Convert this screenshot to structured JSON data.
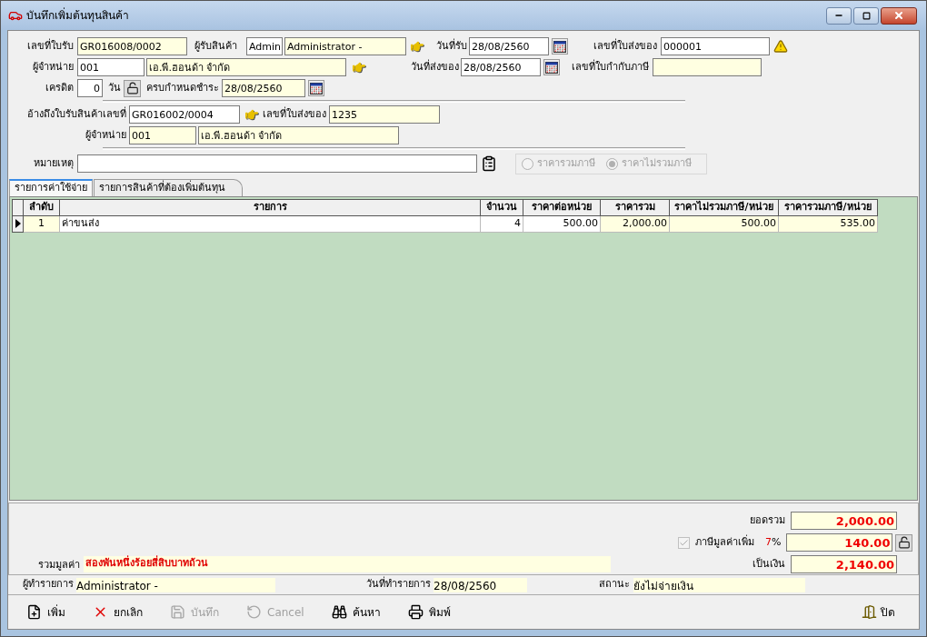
{
  "window": {
    "title": "บันทึกเพิ่มต้นทุนสินค้า"
  },
  "header": {
    "receipt_no": {
      "label": "เลขที่ใบรับ",
      "value": "GR016008/0002",
      "readonly": true
    },
    "receiver": {
      "label": "ผู้รับสินค้า",
      "code": "Admin",
      "name": "Administrator -",
      "readonly": false
    },
    "receive_date": {
      "label": "วันที่รับ",
      "value": "28/08/2560",
      "readonly": false
    },
    "delivery_no": {
      "label": "เลขที่ใบส่งของ",
      "value": "000001",
      "readonly": false,
      "warning": true
    },
    "supplier": {
      "label": "ผู้จำหน่าย",
      "code": "001",
      "name": "เอ.พี.ฮอนด้า จำกัด",
      "readonly": false
    },
    "delivery_date": {
      "label": "วันที่ส่งของ",
      "value": "28/08/2560",
      "readonly": false
    },
    "tax_invoice_no": {
      "label": "เลขที่ใบกำกับภาษี",
      "readonly": true
    },
    "credit": {
      "label": "เครดิต",
      "value": "0",
      "unit": "วัน",
      "readonly": false
    },
    "due_date": {
      "label": "ครบกำหนดชำระ",
      "value": "28/08/2560",
      "readonly": true
    },
    "reference": {
      "label": "อ้างถึงใบรับสินค้าเลขที่",
      "value": "GR016002/0004",
      "readonly": false
    },
    "ref_delivery_no": {
      "label": "เลขที่ใบส่งของ",
      "value": "1235",
      "readonly": true
    },
    "ref_supplier": {
      "label": "ผู้จำหน่าย",
      "code": "001",
      "name": "เอ.พี.ฮอนด้า จำกัด",
      "readonly": true
    },
    "note": {
      "label": "หมายเหตุ",
      "readonly": false
    },
    "price_mode": [
      {
        "label": "ราคารวมภาษี",
        "selected": false,
        "disabled": true
      },
      {
        "label": "ราคาไม่รวมภาษี",
        "selected": true,
        "disabled": true
      }
    ]
  },
  "tabs": [
    {
      "label": "รายการค่าใช้จ่าย",
      "selected": true
    },
    {
      "label": "รายการสินค้าที่ต้องเพิ่มต้นทุน",
      "selected": false
    }
  ],
  "table": {
    "columns": [
      {
        "label": "ลำดับ",
        "kind": "index",
        "readonly": true
      },
      {
        "label": "รายการ",
        "kind": "text",
        "readonly": false
      },
      {
        "label": "จำนวน",
        "kind": "number",
        "readonly": false
      },
      {
        "label": "ราคาต่อหน่วย",
        "kind": "number",
        "readonly": false
      },
      {
        "label": "ราคารวม",
        "kind": "number",
        "readonly": true
      },
      {
        "label": "ราคาไม่รวมภาษี/หน่วย",
        "kind": "number",
        "readonly": true
      },
      {
        "label": "ราคารวมภาษี/หน่วย",
        "kind": "number",
        "readonly": true
      }
    ],
    "rows": [
      {
        "selected": true,
        "cells": [
          "1",
          "ค่าขนส่ง",
          "4",
          "500.00",
          "2,000.00",
          "500.00",
          "535.00"
        ]
      }
    ]
  },
  "totals": {
    "subtotal": {
      "label": "ยอดรวม",
      "value": "2,000.00"
    },
    "vat": {
      "checked": true,
      "disabled": true,
      "label": "ภาษีมูลค่าเพิ่ม",
      "rate": "7",
      "unit": "%",
      "value": "140.00"
    },
    "grand_total": {
      "label": "เป็นเงิน",
      "value": "2,140.00"
    },
    "amount_in_words": {
      "label": "รวมมูลค่า",
      "value": "สองพันหนึ่งร้อยสี่สิบบาทถ้วน"
    }
  },
  "footer": {
    "creator": {
      "label": "ผู้ทำรายการ",
      "value": "Administrator -"
    },
    "date": {
      "label": "วันที่ทำรายการ",
      "value": "28/08/2560"
    },
    "status": {
      "label": "สถานะ",
      "value": "ยังไม่จ่ายเงิน"
    }
  },
  "toolbar": [
    {
      "label": "เพิ่ม",
      "kind": "new",
      "disabled": false
    },
    {
      "label": "ยกเลิก",
      "kind": "delete",
      "disabled": false
    },
    {
      "label": "บันทึก",
      "kind": "save",
      "disabled": true
    },
    {
      "label": "Cancel",
      "kind": "cancel",
      "disabled": true
    },
    {
      "label": "ค้นหา",
      "kind": "search",
      "disabled": false
    },
    {
      "label": "พิมพ์",
      "kind": "print",
      "disabled": false
    }
  ],
  "close_button": {
    "label": "ปิด"
  }
}
